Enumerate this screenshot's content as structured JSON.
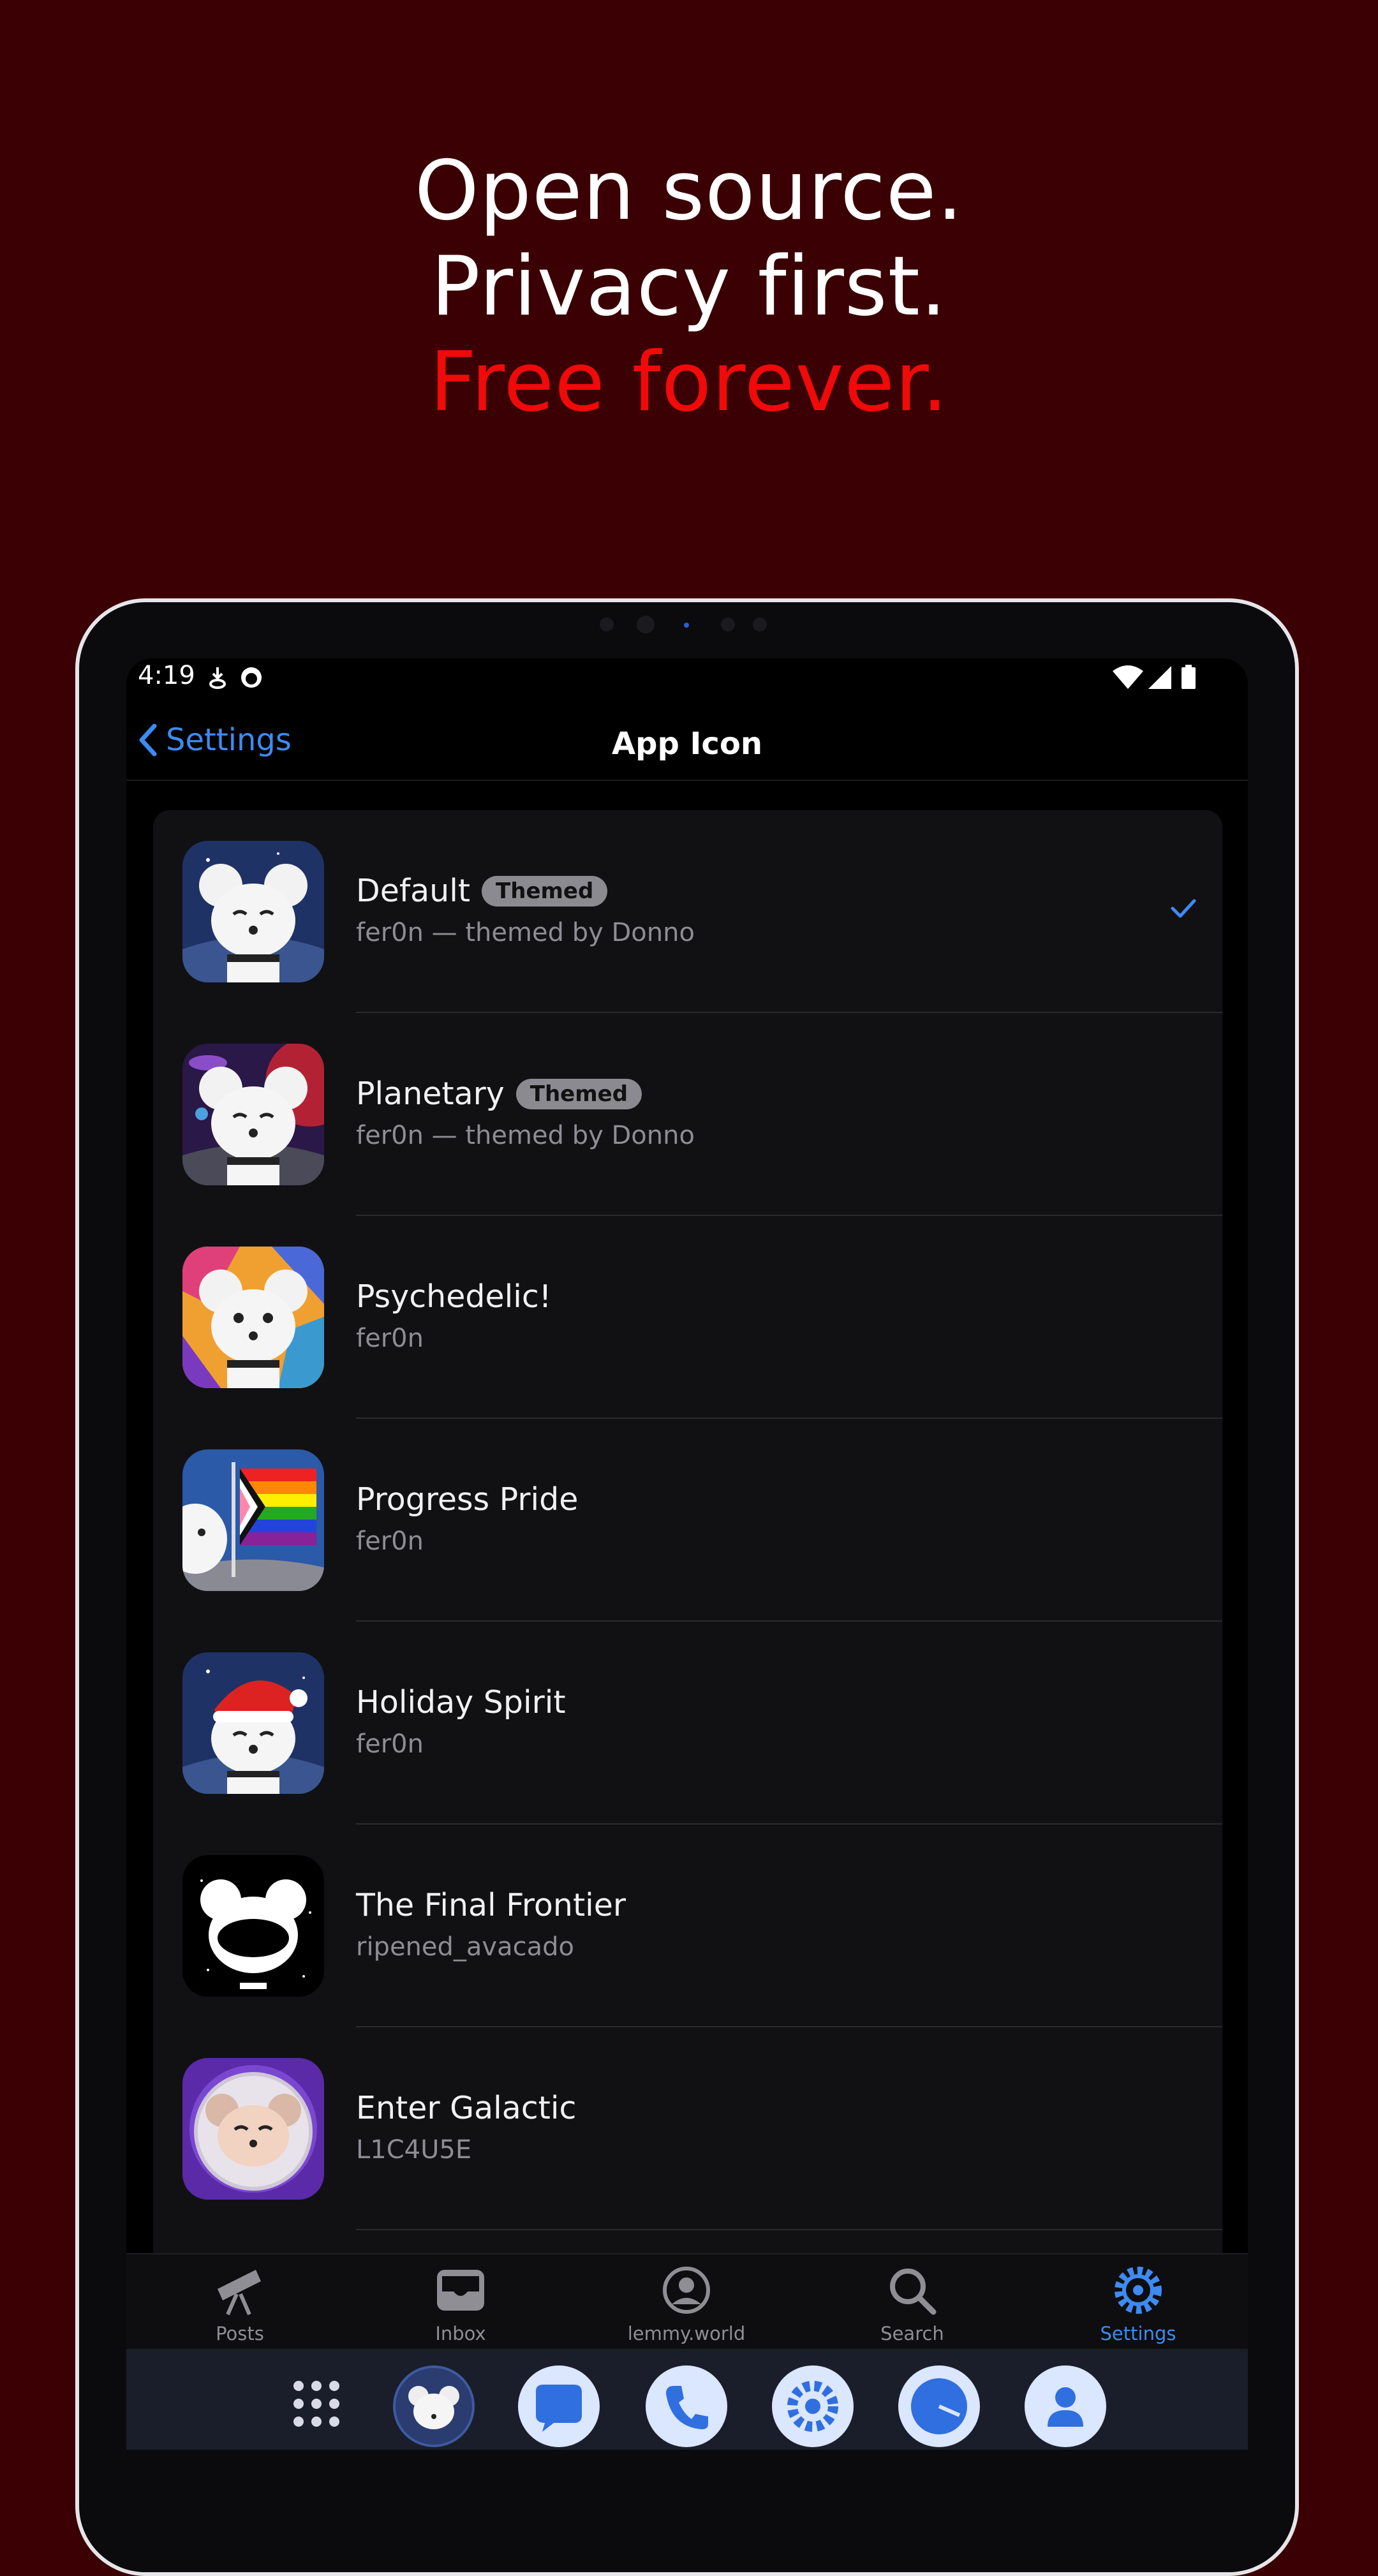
{
  "headline": {
    "line1": "Open source.",
    "line2": "Privacy first.",
    "line3": "Free forever."
  },
  "colors": {
    "background": "#3a0003",
    "accent_red": "#f00a0a",
    "ios_blue": "#3d8bf2"
  },
  "status_bar": {
    "time": "4:19",
    "icons": [
      "download-notification-icon",
      "sync-icon",
      "wifi-icon",
      "signal-icon",
      "battery-icon"
    ]
  },
  "nav": {
    "back_label": "Settings",
    "title": "App Icon"
  },
  "icons_list": [
    {
      "title": "Default",
      "badge": "Themed",
      "subtitle": "fer0n — themed by Donno",
      "selected": true
    },
    {
      "title": "Planetary",
      "badge": "Themed",
      "subtitle": "fer0n — themed by Donno",
      "selected": false
    },
    {
      "title": "Psychedelic!",
      "subtitle": "fer0n",
      "selected": false
    },
    {
      "title": "Progress Pride",
      "subtitle": "fer0n",
      "selected": false
    },
    {
      "title": "Holiday Spirit",
      "subtitle": "fer0n",
      "selected": false
    },
    {
      "title": "The Final Frontier",
      "subtitle": "ripened_avacado",
      "selected": false
    },
    {
      "title": "Enter Galactic",
      "subtitle": "L1C4U5E",
      "selected": false
    }
  ],
  "tabs": [
    {
      "label": "Posts",
      "icon": "telescope-icon"
    },
    {
      "label": "Inbox",
      "icon": "inbox-tray-icon"
    },
    {
      "label": "lemmy.world",
      "icon": "profile-circle-icon"
    },
    {
      "label": "Search",
      "icon": "magnifier-icon"
    },
    {
      "label": "Settings",
      "icon": "gear-icon",
      "active": true
    }
  ],
  "dock": [
    "app-drawer-icon",
    "mlem-app-icon",
    "messages-app-icon",
    "phone-app-icon",
    "settings-app-icon",
    "clock-app-icon",
    "contacts-app-icon"
  ]
}
